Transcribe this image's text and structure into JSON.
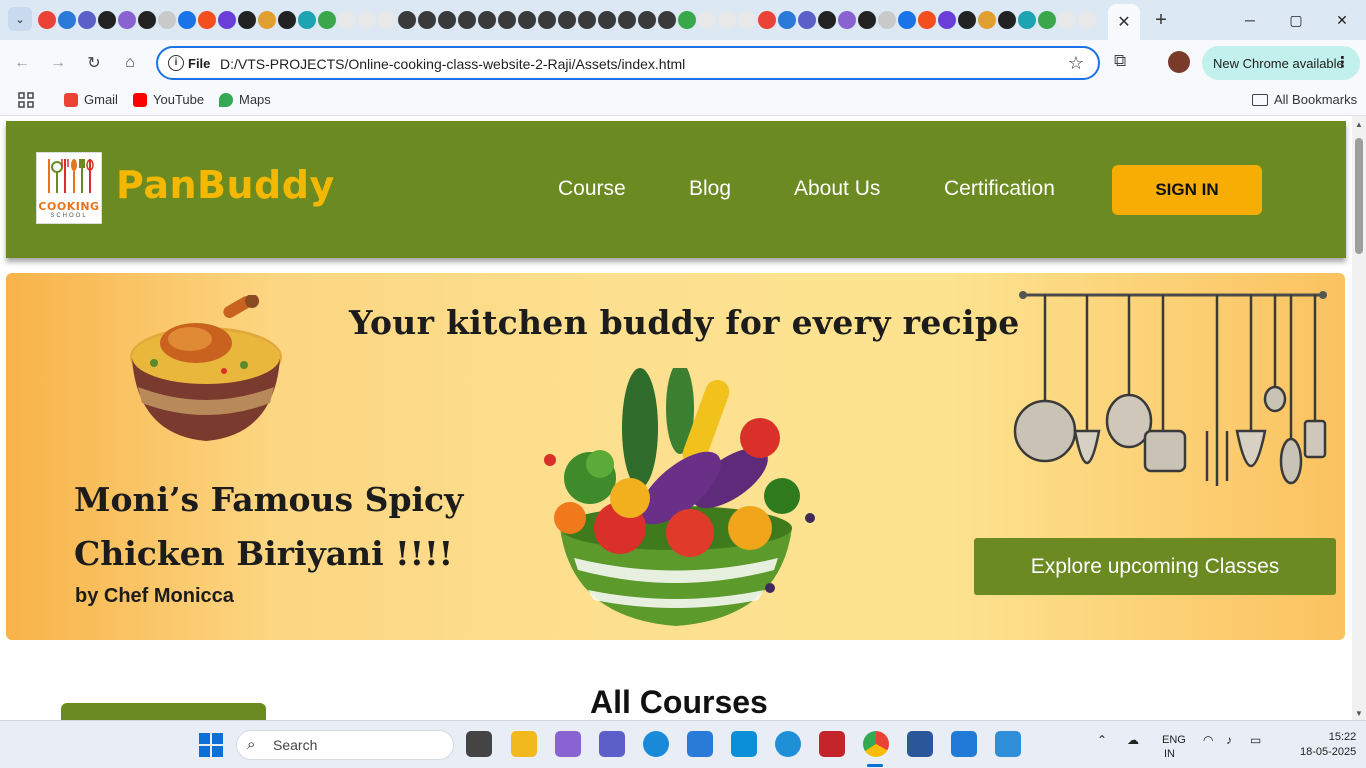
{
  "browser": {
    "active_tab_close": "✕",
    "new_tab": "+",
    "window_controls": {
      "minimize": "─",
      "maximize": "▢",
      "close": "✕"
    },
    "omnibox": {
      "scheme": "File",
      "url": "D:/VTS-PROJECTS/Online-cooking-class-website-2-Raji/Assets/index.html"
    },
    "update_label": "New Chrome available",
    "bookmarks": [
      {
        "label": "Gmail",
        "icon": "gmail-icon",
        "color": "#ea4335"
      },
      {
        "label": "YouTube",
        "icon": "youtube-icon",
        "color": "#ff0000"
      },
      {
        "label": "Maps",
        "icon": "maps-icon",
        "color": "#34a853"
      }
    ],
    "all_bookmarks": "All Bookmarks"
  },
  "site": {
    "logo_text": "COOKING",
    "logo_sub": "SCHOOL",
    "brand": "PanBuddy",
    "nav": [
      "Course",
      "Blog",
      "About Us",
      "Certification"
    ],
    "signin": "SIGN IN",
    "colors": {
      "header": "#6b8a21",
      "brand": "#f5b800",
      "signin": "#f7ad03"
    }
  },
  "hero": {
    "title": "Your kitchen buddy for every recipe",
    "dish": "Moni’s Famous Spicy Chicken Biriyani !!!!",
    "chef": "by Chef Monicca",
    "cta": "Explore upcoming Classes"
  },
  "section": {
    "title": "All Courses"
  },
  "taskbar": {
    "search": "Search",
    "lang_line1": "ENG",
    "lang_line2": "IN",
    "time": "15:22",
    "date": "18-05-2025"
  }
}
